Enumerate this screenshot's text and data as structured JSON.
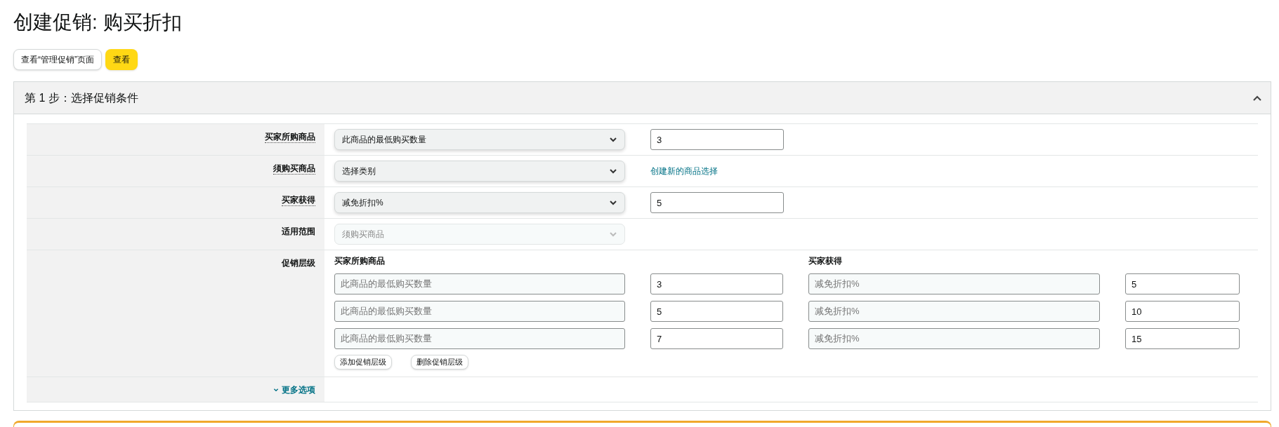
{
  "title": "创建促销: 购买折扣",
  "buttons": [
    {
      "label": "查看“管理促销”页面",
      "kind": "secondary"
    },
    {
      "label": "查看",
      "kind": "primary"
    }
  ],
  "step": {
    "title": "第 1 步：选择促销条件",
    "expanded": true
  },
  "fields": [
    {
      "label": "买家所购商品",
      "tooltip": true,
      "select": "此商品的最低购买数量",
      "disabled": false,
      "kind": "input",
      "value": "3"
    },
    {
      "label": "须购买商品",
      "tooltip": true,
      "select": "选择类别",
      "disabled": false,
      "kind": "link",
      "link": "创建新的商品选择"
    },
    {
      "label": "买家获得",
      "tooltip": true,
      "select": "减免折扣%",
      "disabled": false,
      "kind": "input",
      "value": "5"
    },
    {
      "label": "适用范围",
      "tooltip": false,
      "select": "须购买商品",
      "disabled": true,
      "kind": "none"
    }
  ],
  "tiers": {
    "label": "促销层级",
    "condition_header": "买家所购商品",
    "benefit_header": "买家获得",
    "rows": [
      {
        "condition": "此商品的最低购买数量",
        "quantity": "3",
        "benefit": "减免折扣%",
        "amount": "5"
      },
      {
        "condition": "此商品的最低购买数量",
        "quantity": "5",
        "benefit": "减免折扣%",
        "amount": "10"
      },
      {
        "condition": "此商品的最低购买数量",
        "quantity": "7",
        "benefit": "减免折扣%",
        "amount": "15"
      }
    ],
    "actions": [
      "添加促销层级",
      "删除促销层级"
    ]
  },
  "more_options": {
    "label": "更多选项",
    "expanded": false
  }
}
